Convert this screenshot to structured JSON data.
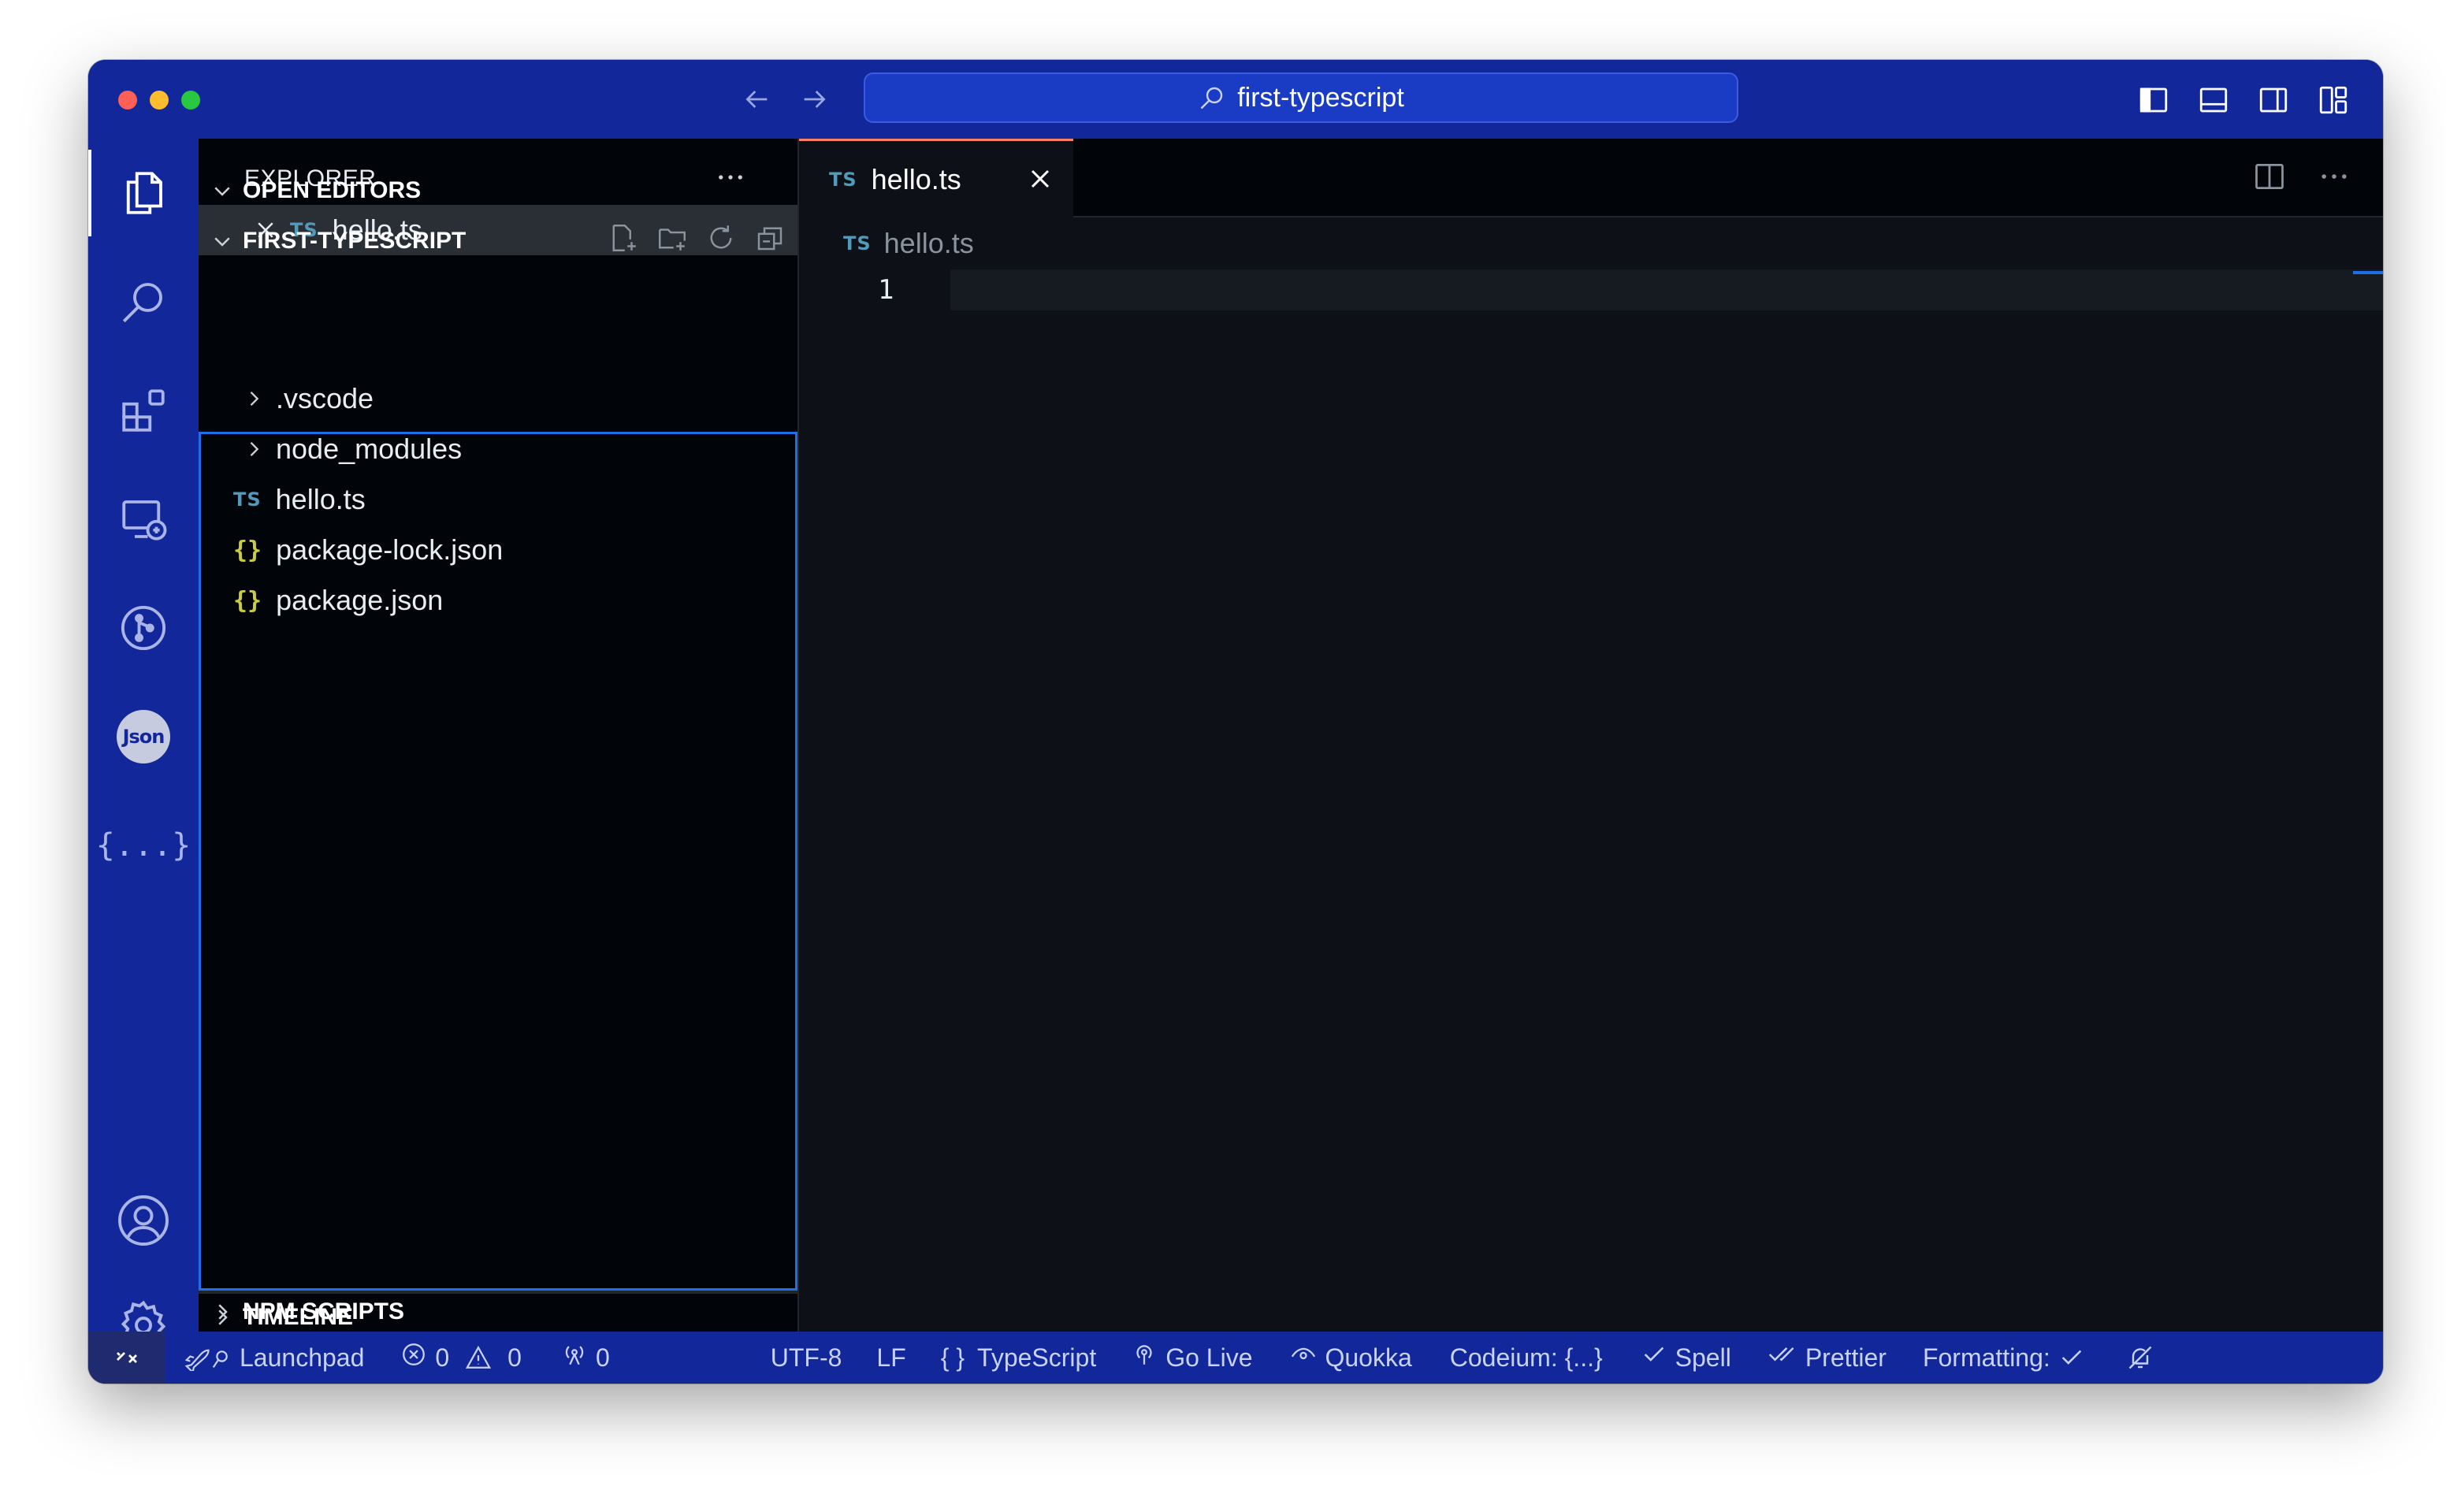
{
  "titlebar": {
    "search_text": "first-typescript"
  },
  "sidebar": {
    "title": "EXPLORER",
    "open_editors": {
      "label": "OPEN EDITORS",
      "items": [
        {
          "badge": "TS",
          "name": "hello.ts"
        }
      ]
    },
    "project": {
      "label": "FIRST-TYPESCRIPT",
      "items": [
        {
          "type": "folder",
          "name": ".vscode"
        },
        {
          "type": "folder",
          "name": "node_modules"
        },
        {
          "type": "ts",
          "badge": "TS",
          "name": "hello.ts"
        },
        {
          "type": "json",
          "badge": "{}",
          "name": "package-lock.json"
        },
        {
          "type": "json",
          "badge": "{}",
          "name": "package.json"
        }
      ]
    },
    "timeline_label": "TIMELINE",
    "npm_scripts_label": "NPM SCRIPTS"
  },
  "activitybar": {
    "json_badge": "Json",
    "braces_label": "{...}"
  },
  "editor": {
    "tab": {
      "badge": "TS",
      "label": "hello.ts"
    },
    "breadcrumb": {
      "badge": "TS",
      "label": "hello.ts"
    },
    "line_number": "1"
  },
  "statusbar": {
    "launchpad": "Launchpad",
    "errors": "0",
    "warnings": "0",
    "ports": "0",
    "encoding": "UTF-8",
    "eol": "LF",
    "language": "TypeScript",
    "language_icon": "{ }",
    "go_live": "Go Live",
    "quokka": "Quokka",
    "codeium": "Codeium: {...}",
    "spell": "Spell",
    "prettier": "Prettier",
    "formatting": "Formatting:"
  },
  "colors": {
    "chrome_blue": "#12289a",
    "sidebar_bg": "#010409",
    "editor_bg": "#0d1117",
    "ts_icon": "#519aba",
    "json_icon": "#cbcb41",
    "tab_accent": "#f78166",
    "focus_border": "#1f6feb"
  }
}
